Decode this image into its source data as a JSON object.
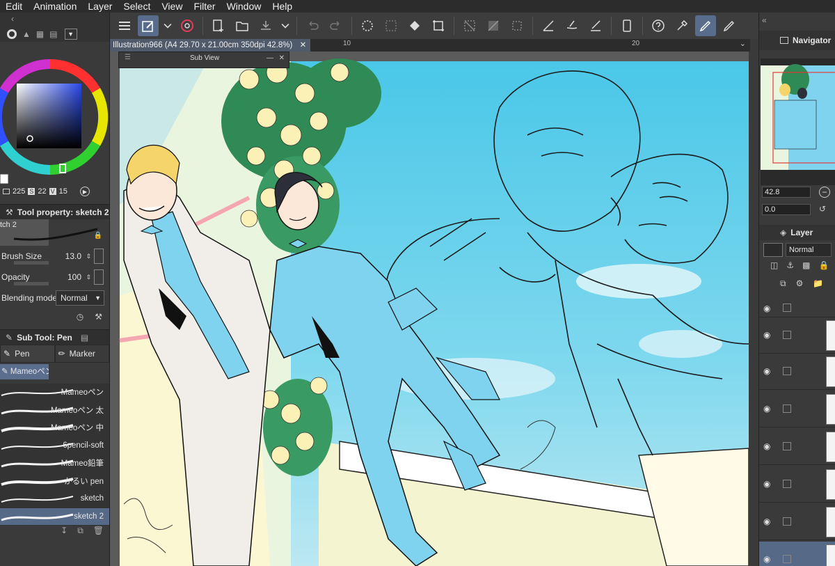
{
  "menu": {
    "items": [
      "Edit",
      "Animation",
      "Layer",
      "Select",
      "View",
      "Filter",
      "Window",
      "Help"
    ]
  },
  "document": {
    "tab_title": "Illustration966 (A4 29.70 x 21.00cm 350dpi 42.8%)",
    "ruler_marks": [
      "10",
      "20"
    ]
  },
  "subview": {
    "title": "Sub View"
  },
  "color": {
    "hsv": {
      "h": "225",
      "s_label": "S",
      "s": "22",
      "v_label": "V",
      "v": "15"
    }
  },
  "tool_property": {
    "header": "Tool property: sketch 2",
    "brush_name": "tch 2",
    "brush_size_label": "Brush Size",
    "brush_size": "13.0",
    "opacity_label": "Opacity",
    "opacity": "100",
    "blending_label": "Blending mode",
    "blending_value": "Normal"
  },
  "sub_tool": {
    "header": "Sub Tool: Pen",
    "tabs": [
      "Pen",
      "Marker"
    ],
    "group_tab": "Mameoペン",
    "brushes": [
      "Mameoペン",
      "Mameoペン 太",
      "Mameoペン 中",
      "6pencil-soft",
      "Mameo鉛筆",
      "かるい pen",
      "sketch",
      "sketch 2"
    ],
    "selected_index": 7
  },
  "navigator": {
    "header": "Navigator",
    "zoom": "42.8",
    "rotation": "0.0"
  },
  "layer_panel": {
    "header": "Layer",
    "blend_mode": "Normal"
  },
  "colors": {
    "accent": "#5a6c8c",
    "sky": "#6fd0e8",
    "suit_blue": "#7fd3ee",
    "selection": "#566987"
  }
}
